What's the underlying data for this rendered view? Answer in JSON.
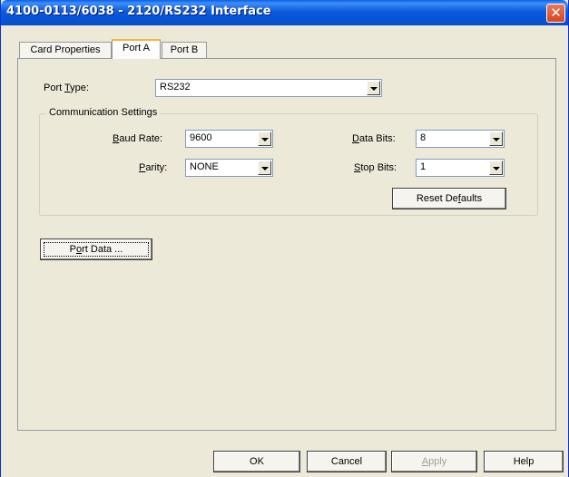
{
  "window": {
    "title": "4100-0113/6038 - 2120/RS232 Interface",
    "close_icon_glyph": "✕"
  },
  "tabs": [
    {
      "label": "Card Properties",
      "active": false
    },
    {
      "label": "Port A",
      "active": true
    },
    {
      "label": "Port B",
      "active": false
    }
  ],
  "port": {
    "type_label_pre": "Port ",
    "type_label_u": "T",
    "type_label_post": "ype:",
    "type_value": "RS232"
  },
  "comm": {
    "legend": "Communication Settings",
    "baud": {
      "label_u": "B",
      "label_rest": "aud Rate:",
      "value": "9600"
    },
    "parity": {
      "label_u": "P",
      "label_rest": "arity:",
      "value": "NONE"
    },
    "data_bits": {
      "label_u": "D",
      "label_rest": "ata Bits:",
      "value": "8"
    },
    "stop_bits": {
      "label_u": "S",
      "label_rest": "top Bits:",
      "value": "1"
    },
    "reset_pre": "Reset De",
    "reset_u": "f",
    "reset_post": "aults"
  },
  "port_data": {
    "pre": "P",
    "u": "o",
    "post": "rt Data ..."
  },
  "footer": {
    "ok": "OK",
    "cancel": "Cancel",
    "apply_u": "A",
    "apply_rest": "pply",
    "help": "Help"
  }
}
